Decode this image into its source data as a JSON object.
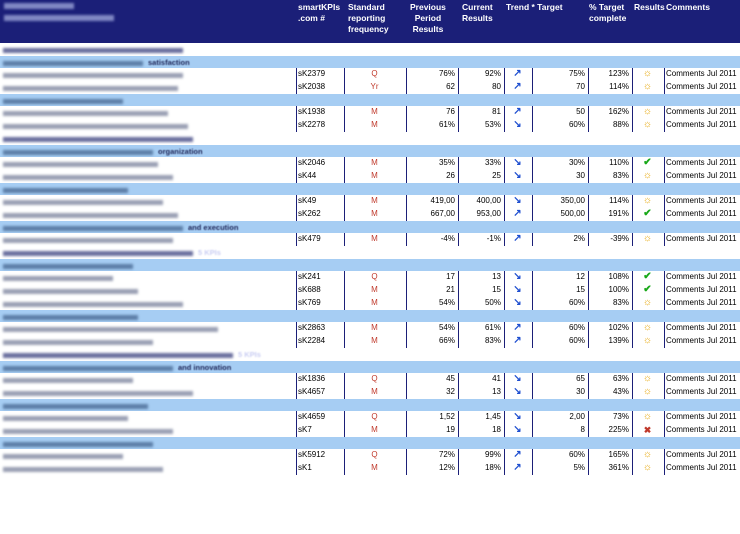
{
  "columns": {
    "kpi": "smartKPIs\n.com #",
    "frequency": "Standard\nreporting\nfrequency",
    "previous": "Previous\nPeriod\nResults",
    "current": "Current\nResults",
    "trend_target": "Trend * Target",
    "target_complete": "% Target\ncomplete",
    "results": "Results",
    "comments": "Comments"
  },
  "icons": {
    "up": "trend-up-arrow-icon",
    "down": "trend-down-arrow-icon",
    "sun": "sun-status-icon",
    "check": "checkmark-status-icon",
    "bad": "warning-status-icon"
  },
  "colors": {
    "header": "#1b1f78",
    "section": "#2c338a",
    "subsection": "#a6cdf3",
    "frequency_text": "#c0392b",
    "trend_arrow": "#1f4fd0",
    "check": "#18a818",
    "sun": "#e6a400"
  },
  "rows": [
    {
      "type": "section",
      "text": "",
      "bar": 180
    },
    {
      "type": "sub",
      "text": "satisfaction",
      "bar": 140
    },
    {
      "type": "data",
      "id": "sK2379",
      "freq": "Q",
      "prev": "76%",
      "curr": "92%",
      "trend": "up",
      "target": "75%",
      "pct": "123%",
      "status": "sun",
      "comment": "Comments Jul 2011",
      "bar": 180
    },
    {
      "type": "data",
      "id": "sK2038",
      "freq": "Yr",
      "prev": "62",
      "curr": "80",
      "trend": "up",
      "target": "70",
      "pct": "114%",
      "status": "sun",
      "comment": "Comments Jul 2011",
      "bar": 175
    },
    {
      "type": "sub",
      "text": "",
      "bar": 120
    },
    {
      "type": "data",
      "id": "sK1938",
      "freq": "M",
      "prev": "76",
      "curr": "81",
      "trend": "up",
      "target": "50",
      "pct": "162%",
      "status": "sun",
      "comment": "Comments Jul 2011",
      "bar": 165
    },
    {
      "type": "data",
      "id": "sK2278",
      "freq": "M",
      "prev": "61%",
      "curr": "53%",
      "trend": "down",
      "target": "60%",
      "pct": "88%",
      "status": "sun",
      "comment": "Comments Jul 2011",
      "bar": 185
    },
    {
      "type": "section",
      "text": "",
      "bar": 190
    },
    {
      "type": "sub",
      "text": "organization",
      "bar": 150
    },
    {
      "type": "data",
      "id": "sK2046",
      "freq": "M",
      "prev": "35%",
      "curr": "33%",
      "trend": "down",
      "target": "30%",
      "pct": "110%",
      "status": "check",
      "comment": "Comments Jul 2011",
      "bar": 155
    },
    {
      "type": "data",
      "id": "sK44",
      "freq": "M",
      "prev": "26",
      "curr": "25",
      "trend": "down",
      "target": "30",
      "pct": "83%",
      "status": "sun",
      "comment": "Comments Jul 2011",
      "bar": 170
    },
    {
      "type": "sub",
      "text": "",
      "bar": 125
    },
    {
      "type": "data",
      "id": "sK49",
      "freq": "M",
      "prev": "419,00",
      "curr": "400,00",
      "trend": "down",
      "target": "350,00",
      "pct": "114%",
      "status": "sun",
      "comment": "Comments Jul 2011",
      "bar": 160
    },
    {
      "type": "data",
      "id": "sK262",
      "freq": "M",
      "prev": "667,00",
      "curr": "953,00",
      "trend": "up",
      "target": "500,00",
      "pct": "191%",
      "status": "check",
      "comment": "Comments Jul 2011",
      "bar": 175
    },
    {
      "type": "sub",
      "text": "and execution",
      "bar": 180
    },
    {
      "type": "data",
      "id": "sK479",
      "freq": "M",
      "prev": "-4%",
      "curr": "-1%",
      "trend": "up",
      "target": "2%",
      "pct": "-39%",
      "status": "sun",
      "comment": "Comments Jul 2011",
      "bar": 170
    },
    {
      "type": "section",
      "text": "5 KPIs",
      "bar": 190
    },
    {
      "type": "sub",
      "text": "",
      "bar": 130
    },
    {
      "type": "data",
      "id": "sK241",
      "freq": "Q",
      "prev": "17",
      "curr": "13",
      "trend": "down",
      "target": "12",
      "pct": "108%",
      "status": "check",
      "comment": "Comments Jul 2011",
      "bar": 110
    },
    {
      "type": "data",
      "id": "sK688",
      "freq": "M",
      "prev": "21",
      "curr": "15",
      "trend": "down",
      "target": "15",
      "pct": "100%",
      "status": "check",
      "comment": "Comments Jul 2011",
      "bar": 135
    },
    {
      "type": "data",
      "id": "sK769",
      "freq": "M",
      "prev": "54%",
      "curr": "50%",
      "trend": "down",
      "target": "60%",
      "pct": "83%",
      "status": "sun",
      "comment": "Comments Jul 2011",
      "bar": 180
    },
    {
      "type": "sub",
      "text": "",
      "bar": 135
    },
    {
      "type": "data",
      "id": "sK2863",
      "freq": "M",
      "prev": "54%",
      "curr": "61%",
      "trend": "up",
      "target": "60%",
      "pct": "102%",
      "status": "sun",
      "comment": "Comments Jul 2011",
      "bar": 215
    },
    {
      "type": "data",
      "id": "sK2284",
      "freq": "M",
      "prev": "66%",
      "curr": "83%",
      "trend": "up",
      "target": "60%",
      "pct": "139%",
      "status": "sun",
      "comment": "Comments Jul 2011",
      "bar": 150
    },
    {
      "type": "section",
      "text": "5 KPIs",
      "bar": 230
    },
    {
      "type": "sub",
      "text": "and innovation",
      "bar": 170
    },
    {
      "type": "data",
      "id": "sK1836",
      "freq": "Q",
      "prev": "45",
      "curr": "41",
      "trend": "down",
      "target": "65",
      "pct": "63%",
      "status": "sun",
      "comment": "Comments Jul 2011",
      "bar": 130
    },
    {
      "type": "data",
      "id": "sK4657",
      "freq": "M",
      "prev": "32",
      "curr": "13",
      "trend": "down",
      "target": "30",
      "pct": "43%",
      "status": "sun",
      "comment": "Comments Jul 2011",
      "bar": 190
    },
    {
      "type": "sub",
      "text": "",
      "bar": 145
    },
    {
      "type": "data",
      "id": "sK4659",
      "freq": "Q",
      "prev": "1,52",
      "curr": "1,45",
      "trend": "down",
      "target": "2,00",
      "pct": "73%",
      "status": "sun",
      "comment": "Comments Jul 2011",
      "bar": 125
    },
    {
      "type": "data",
      "id": "sK7",
      "freq": "M",
      "prev": "19",
      "curr": "18",
      "trend": "down",
      "target": "8",
      "pct": "225%",
      "status": "bad",
      "comment": "Comments Jul 2011",
      "bar": 170
    },
    {
      "type": "sub",
      "text": "",
      "bar": 150
    },
    {
      "type": "data",
      "id": "sK5912",
      "freq": "Q",
      "prev": "72%",
      "curr": "99%",
      "trend": "up",
      "target": "60%",
      "pct": "165%",
      "status": "sun",
      "comment": "Comments Jul 2011",
      "bar": 120
    },
    {
      "type": "data",
      "id": "sK1",
      "freq": "M",
      "prev": "12%",
      "curr": "18%",
      "trend": "up",
      "target": "5%",
      "pct": "361%",
      "status": "sun",
      "comment": "Comments Jul 2011",
      "bar": 160
    }
  ]
}
